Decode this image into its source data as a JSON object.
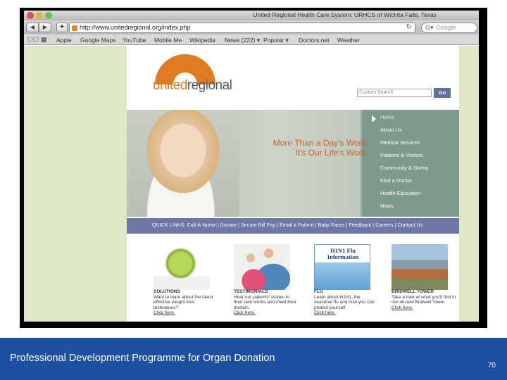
{
  "slide": {
    "footer_text": "Professional Development Programme for Organ Donation",
    "page_number": "70",
    "colors": {
      "footer_bg": "#1f4fa0",
      "accent_orange": "#e07b22",
      "hero_teal": "#7d9a8c",
      "quicklinks_blue": "#6d77a8",
      "page_green": "#dfe8c6"
    }
  },
  "browser": {
    "window_title": "United Regional Health Care System: URHCS of Wichita Falls, Texas",
    "back_icon": "back-arrow-icon",
    "forward_icon": "forward-arrow-icon",
    "add_bookmark": "+",
    "url": "http://www.unitedregional.org/index.php",
    "reload_icon": "reload-icon",
    "search_prefix": "G▾",
    "search_placeholder": "Google",
    "bookmarks": [
      "Apple",
      "Google Maps",
      "YouTube",
      "Mobile Me",
      "Wikipedia",
      "News (222) ▾",
      "Popular ▾",
      "Doctors.net",
      "Weather"
    ]
  },
  "site": {
    "logo_prefix": "united",
    "logo_suffix": "regional",
    "search_placeholder": "Custom Search",
    "search_button": "Go",
    "tagline_line1": "More Than a Day's Work.",
    "tagline_line2": "It's Our Life's Work.",
    "nav": [
      "Home",
      "About Us",
      "Medical Services",
      "Patients & Visitors",
      "Community & Giving",
      "Find a Doctor",
      "Health Education",
      "News"
    ],
    "quicklinks": "QUICK LINKS:  Call-A-Nurse  |  Donate  |  Secure Bill Pay  |  Email a Patient  |  Baby Faces  |  Feedback  |  Careers  |  Contact Us",
    "features": [
      {
        "title": "SOLUTIONS",
        "body": "Want to learn about the latest effective weight loss techniques?",
        "link": "Click here."
      },
      {
        "title": "TESTIMONIALS",
        "body": "Hear our patients' stories in their own words and meet their doctors.",
        "link": "Click here."
      },
      {
        "title": "FLU",
        "image_caption": "H1N1 Flu Information",
        "body": "Learn about H1N1, the seasonal flu and how you can protect yourself.",
        "link": "Click here."
      },
      {
        "title": "BRIDWELL TOWER",
        "body": "Take a look at what you'll find in our all-new Bridwell Tower.",
        "link": "Click here."
      }
    ]
  }
}
